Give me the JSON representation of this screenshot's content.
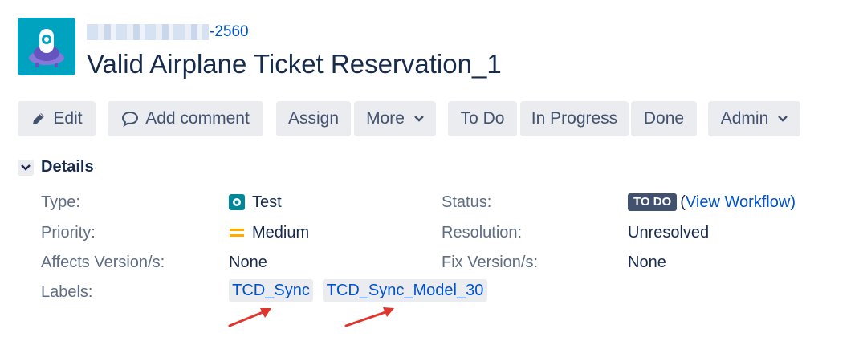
{
  "issue": {
    "key_suffix": "-2560",
    "title": "Valid Airplane Ticket Reservation_1"
  },
  "toolbar": {
    "edit": "Edit",
    "add_comment": "Add comment",
    "assign": "Assign",
    "more": "More",
    "to_do": "To Do",
    "in_progress": "In Progress",
    "done": "Done",
    "admin": "Admin"
  },
  "details": {
    "heading": "Details",
    "type_label": "Type:",
    "type_value": "Test",
    "priority_label": "Priority:",
    "priority_value": "Medium",
    "affects_label": "Affects Version/s:",
    "affects_value": "None",
    "labels_label": "Labels:",
    "labels": [
      "TCD_Sync",
      "TCD_Sync_Model_30"
    ],
    "status_label": "Status:",
    "status_value": "TO DO",
    "status_open_paren": "(",
    "view_workflow": "View Workflow",
    "status_close_paren": ")",
    "resolution_label": "Resolution:",
    "resolution_value": "Unresolved",
    "fix_label": "Fix Version/s:",
    "fix_value": "None"
  },
  "colors": {
    "link": "#0052cc",
    "status_lozenge": "#42526e",
    "annotation_arrow": "#e0342c",
    "priority_medium": "#ffab00",
    "test_type_icon": "#00879a"
  },
  "icons": {
    "project_avatar": "ufo-avatar-icon",
    "edit": "pencil-icon",
    "comment": "speech-bubble-icon",
    "dropdown": "chevron-down-icon",
    "details_toggle": "chevron-down-icon",
    "type": "test-issue-type-icon",
    "priority": "medium-priority-icon"
  }
}
